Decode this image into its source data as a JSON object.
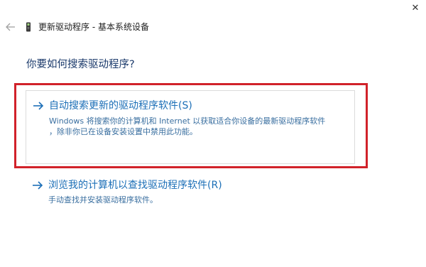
{
  "window": {
    "close_glyph": "✕",
    "title": "更新驱动程序 - 基本系统设备"
  },
  "page": {
    "heading": "你要如何搜索驱动程序?"
  },
  "options": [
    {
      "title": "自动搜索更新的驱动程序软件(S)",
      "description_line1": "Windows 将搜索你的计算机和 Internet 以获取适合你设备的最新驱动程序软件",
      "description_line2": "，除非你已在设备安装设置中禁用此功能。"
    },
    {
      "title": "浏览我的计算机以查找驱动程序软件(R)",
      "description_line1": "手动查找并安装驱动程序软件。"
    }
  ],
  "icons": {
    "back": "arrow-left-icon",
    "device": "device-icon",
    "option_arrow": "arrow-right-icon"
  },
  "colors": {
    "link": "#1c6fb7",
    "heading": "#1b3a6b",
    "highlight": "#d1222a"
  }
}
